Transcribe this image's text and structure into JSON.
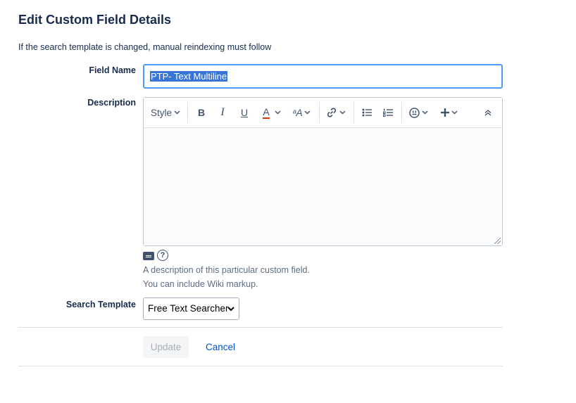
{
  "page": {
    "title": "Edit Custom Field Details",
    "notice": "If the search template is changed, manual reindexing must follow"
  },
  "field_name": {
    "label": "Field Name",
    "value": "PTP- Text Multiline"
  },
  "description": {
    "label": "Description",
    "toolbar": {
      "style_label": "Style",
      "bold": "B",
      "italic": "I",
      "underline": "U",
      "text_color": "A",
      "text_size": "ᵃA"
    },
    "help_line_1": "A description of this particular custom field.",
    "help_line_2": "You can include Wiki markup."
  },
  "search_template": {
    "label": "Search Template",
    "selected": "Free Text Searcher"
  },
  "actions": {
    "update_label": "Update",
    "cancel_label": "Cancel"
  },
  "colors": {
    "focus_border": "#4c9aff",
    "selection": "#3875d7",
    "link": "#0052cc",
    "text_color_underline": "#de350b"
  },
  "icons": [
    "chevron-down-icon",
    "bold-icon",
    "italic-icon",
    "underline-icon",
    "text-color-icon",
    "text-size-icon",
    "link-icon",
    "bullet-list-icon",
    "numbered-list-icon",
    "emoji-icon",
    "insert-icon",
    "collapse-toolbar-icon",
    "wiki-markup-icon",
    "help-icon"
  ]
}
